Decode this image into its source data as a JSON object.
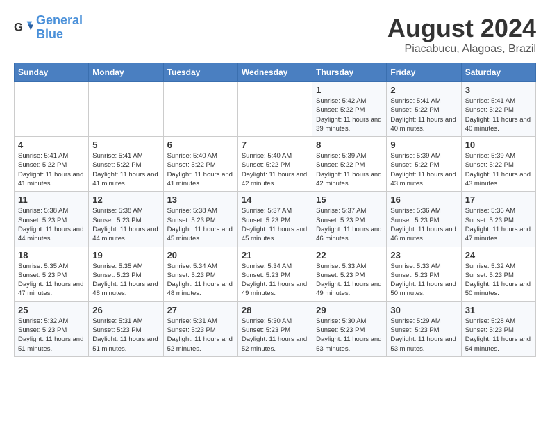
{
  "header": {
    "logo_line1": "General",
    "logo_line2": "Blue",
    "title": "August 2024",
    "subtitle": "Piacabucu, Alagoas, Brazil"
  },
  "days_of_week": [
    "Sunday",
    "Monday",
    "Tuesday",
    "Wednesday",
    "Thursday",
    "Friday",
    "Saturday"
  ],
  "weeks": [
    [
      {
        "day": "",
        "detail": ""
      },
      {
        "day": "",
        "detail": ""
      },
      {
        "day": "",
        "detail": ""
      },
      {
        "day": "",
        "detail": ""
      },
      {
        "day": "1",
        "detail": "Sunrise: 5:42 AM\nSunset: 5:22 PM\nDaylight: 11 hours and 39 minutes."
      },
      {
        "day": "2",
        "detail": "Sunrise: 5:41 AM\nSunset: 5:22 PM\nDaylight: 11 hours and 40 minutes."
      },
      {
        "day": "3",
        "detail": "Sunrise: 5:41 AM\nSunset: 5:22 PM\nDaylight: 11 hours and 40 minutes."
      }
    ],
    [
      {
        "day": "4",
        "detail": "Sunrise: 5:41 AM\nSunset: 5:22 PM\nDaylight: 11 hours and 41 minutes."
      },
      {
        "day": "5",
        "detail": "Sunrise: 5:41 AM\nSunset: 5:22 PM\nDaylight: 11 hours and 41 minutes."
      },
      {
        "day": "6",
        "detail": "Sunrise: 5:40 AM\nSunset: 5:22 PM\nDaylight: 11 hours and 41 minutes."
      },
      {
        "day": "7",
        "detail": "Sunrise: 5:40 AM\nSunset: 5:22 PM\nDaylight: 11 hours and 42 minutes."
      },
      {
        "day": "8",
        "detail": "Sunrise: 5:39 AM\nSunset: 5:22 PM\nDaylight: 11 hours and 42 minutes."
      },
      {
        "day": "9",
        "detail": "Sunrise: 5:39 AM\nSunset: 5:22 PM\nDaylight: 11 hours and 43 minutes."
      },
      {
        "day": "10",
        "detail": "Sunrise: 5:39 AM\nSunset: 5:22 PM\nDaylight: 11 hours and 43 minutes."
      }
    ],
    [
      {
        "day": "11",
        "detail": "Sunrise: 5:38 AM\nSunset: 5:23 PM\nDaylight: 11 hours and 44 minutes."
      },
      {
        "day": "12",
        "detail": "Sunrise: 5:38 AM\nSunset: 5:23 PM\nDaylight: 11 hours and 44 minutes."
      },
      {
        "day": "13",
        "detail": "Sunrise: 5:38 AM\nSunset: 5:23 PM\nDaylight: 11 hours and 45 minutes."
      },
      {
        "day": "14",
        "detail": "Sunrise: 5:37 AM\nSunset: 5:23 PM\nDaylight: 11 hours and 45 minutes."
      },
      {
        "day": "15",
        "detail": "Sunrise: 5:37 AM\nSunset: 5:23 PM\nDaylight: 11 hours and 46 minutes."
      },
      {
        "day": "16",
        "detail": "Sunrise: 5:36 AM\nSunset: 5:23 PM\nDaylight: 11 hours and 46 minutes."
      },
      {
        "day": "17",
        "detail": "Sunrise: 5:36 AM\nSunset: 5:23 PM\nDaylight: 11 hours and 47 minutes."
      }
    ],
    [
      {
        "day": "18",
        "detail": "Sunrise: 5:35 AM\nSunset: 5:23 PM\nDaylight: 11 hours and 47 minutes."
      },
      {
        "day": "19",
        "detail": "Sunrise: 5:35 AM\nSunset: 5:23 PM\nDaylight: 11 hours and 48 minutes."
      },
      {
        "day": "20",
        "detail": "Sunrise: 5:34 AM\nSunset: 5:23 PM\nDaylight: 11 hours and 48 minutes."
      },
      {
        "day": "21",
        "detail": "Sunrise: 5:34 AM\nSunset: 5:23 PM\nDaylight: 11 hours and 49 minutes."
      },
      {
        "day": "22",
        "detail": "Sunrise: 5:33 AM\nSunset: 5:23 PM\nDaylight: 11 hours and 49 minutes."
      },
      {
        "day": "23",
        "detail": "Sunrise: 5:33 AM\nSunset: 5:23 PM\nDaylight: 11 hours and 50 minutes."
      },
      {
        "day": "24",
        "detail": "Sunrise: 5:32 AM\nSunset: 5:23 PM\nDaylight: 11 hours and 50 minutes."
      }
    ],
    [
      {
        "day": "25",
        "detail": "Sunrise: 5:32 AM\nSunset: 5:23 PM\nDaylight: 11 hours and 51 minutes."
      },
      {
        "day": "26",
        "detail": "Sunrise: 5:31 AM\nSunset: 5:23 PM\nDaylight: 11 hours and 51 minutes."
      },
      {
        "day": "27",
        "detail": "Sunrise: 5:31 AM\nSunset: 5:23 PM\nDaylight: 11 hours and 52 minutes."
      },
      {
        "day": "28",
        "detail": "Sunrise: 5:30 AM\nSunset: 5:23 PM\nDaylight: 11 hours and 52 minutes."
      },
      {
        "day": "29",
        "detail": "Sunrise: 5:30 AM\nSunset: 5:23 PM\nDaylight: 11 hours and 53 minutes."
      },
      {
        "day": "30",
        "detail": "Sunrise: 5:29 AM\nSunset: 5:23 PM\nDaylight: 11 hours and 53 minutes."
      },
      {
        "day": "31",
        "detail": "Sunrise: 5:28 AM\nSunset: 5:23 PM\nDaylight: 11 hours and 54 minutes."
      }
    ]
  ]
}
